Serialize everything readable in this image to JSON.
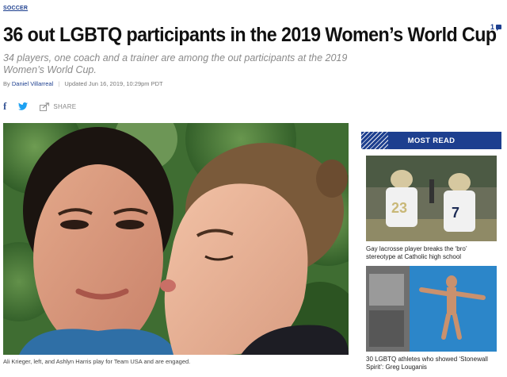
{
  "section": {
    "label": "SOCCER"
  },
  "comments": {
    "count": "1"
  },
  "article": {
    "headline": "36 out LGBTQ participants in the 2019 Women’s World Cup",
    "dek": "34 players, one coach and a trainer are among the out participants at the 2019 Women’s World Cup.",
    "byline_prefix": "By",
    "author": "Daniel Villarreal",
    "updated": "Updated Jun 16, 2019, 10:29pm PDT",
    "share_label": "SHARE",
    "caption": "Ali Krieger, left, and Ashlyn Harris play for Team USA and are engaged."
  },
  "share_icons": [
    "facebook-icon",
    "twitter-icon",
    "share-icon"
  ],
  "sidebar": {
    "heading": "MOST READ",
    "items": [
      {
        "title": "Gay lacrosse player breaks the ‘bro’ stereotype at Catholic high school"
      },
      {
        "title": "30 LGBTQ athletes who showed ‘Stonewall Spirit’: Greg Louganis"
      }
    ]
  },
  "colors": {
    "brand": "#1d3f8f",
    "headline": "#111111",
    "dek": "#8a8a8a"
  }
}
